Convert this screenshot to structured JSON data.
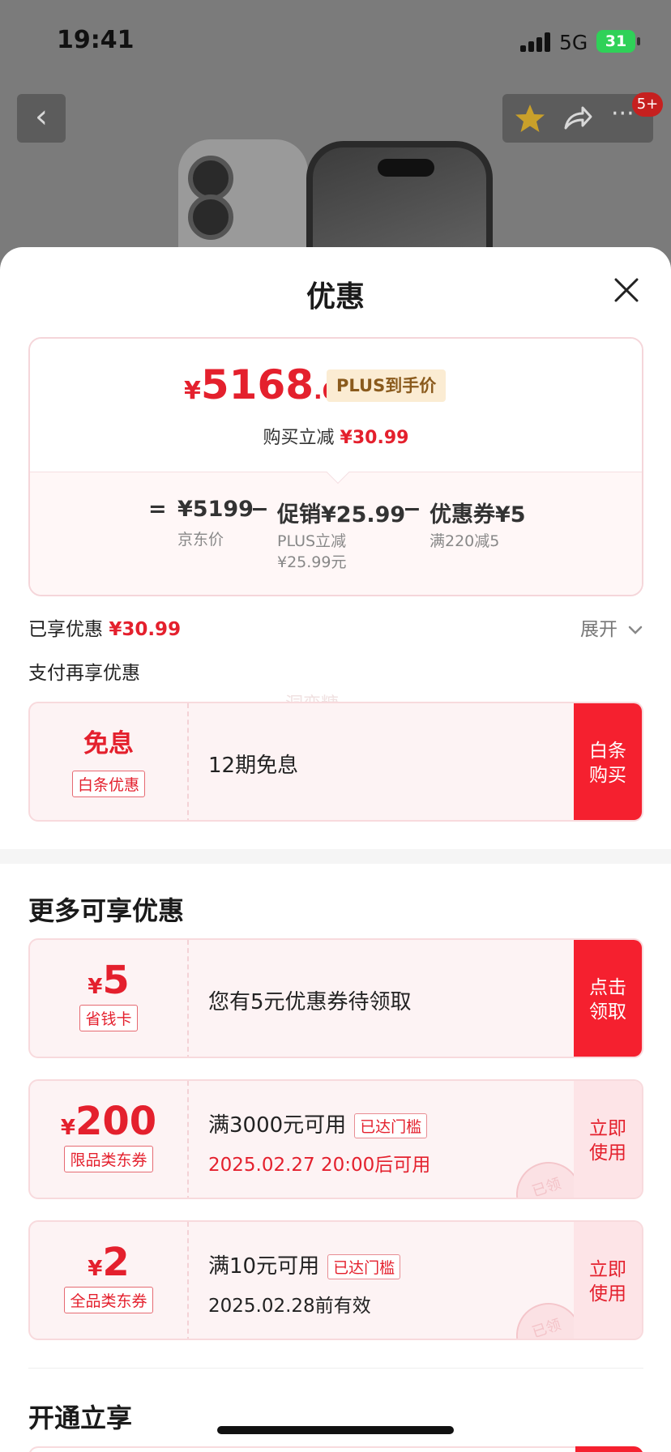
{
  "status_bar": {
    "time": "19:41",
    "network": "5G",
    "battery": "31"
  },
  "header": {
    "cart_badge": "5+"
  },
  "sheet": {
    "title": "优惠",
    "price": {
      "currency": "¥",
      "integer": "5168",
      "decimal": ".01",
      "plus_tag": "PLUS到手价",
      "instant_label": "购买立减",
      "instant_amount": "¥30.99"
    },
    "breakdown": {
      "equals": "=",
      "jd_price": "¥5199",
      "jd_price_label": "京东价",
      "minus1": "−",
      "promo": "促销¥25.99",
      "promo_note_1": "PLUS立减",
      "promo_note_2": "¥25.99元",
      "minus2": "−",
      "coupon": "优惠券¥5",
      "coupon_note": "满220减5"
    },
    "enjoyed_label": "已享优惠",
    "enjoyed_amount": "¥30.99",
    "expand_label": "展开",
    "pay_more_label": "支付再享优惠",
    "watermark": "洞变糖",
    "baitiao": {
      "title": "免息",
      "tag": "白条优惠",
      "desc": "12期免息",
      "cta_line1": "白条",
      "cta_line2": "购买"
    },
    "more_title": "更多可享优惠",
    "coupons": [
      {
        "currency": "¥",
        "amount": "5",
        "tag": "省钱卡",
        "desc": "您有5元优惠券待领取",
        "cta_line1": "点击",
        "cta_line2": "领取"
      },
      {
        "currency": "¥",
        "amount": "200",
        "tag": "限品类东券",
        "desc": "满3000元可用",
        "reached": "已达门槛",
        "time": "2025.02.27 20:00后可用",
        "cta_line1": "立即",
        "cta_line2": "使用",
        "stamp": "已领"
      },
      {
        "currency": "¥",
        "amount": "2",
        "tag": "全品类东券",
        "desc": "满10元可用",
        "reached": "已达门槛",
        "time": "2025.02.28前有效",
        "cta_line1": "立即",
        "cta_line2": "使用",
        "stamp": "已领"
      }
    ],
    "open_title": "开通立享"
  },
  "colors": {
    "accent": "#e4202d",
    "cta": "#f5202f",
    "plus_tag_bg": "#fbecd3"
  },
  "icons": [
    "back-icon",
    "star-icon",
    "share-icon",
    "more-icon",
    "close-icon",
    "chevron-down-icon"
  ]
}
